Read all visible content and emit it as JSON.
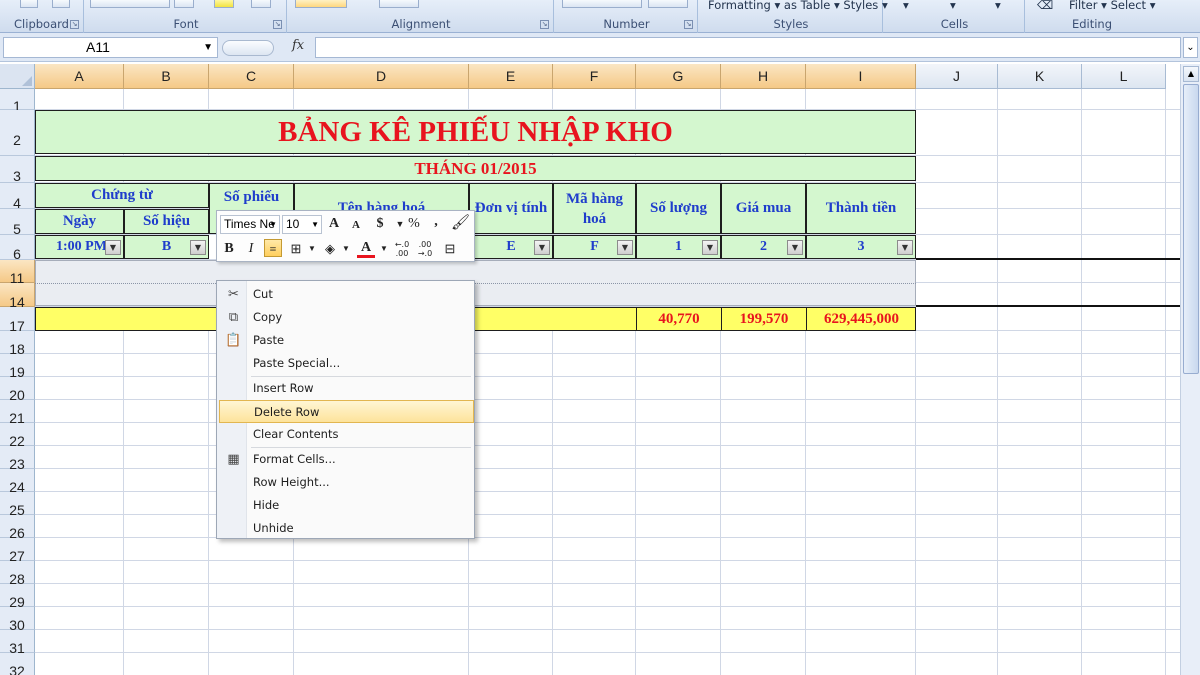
{
  "ribbon": {
    "groups": [
      {
        "label": "Clipboard"
      },
      {
        "label": "Font"
      },
      {
        "label": "Alignment"
      },
      {
        "label": "Number"
      },
      {
        "label": "Styles"
      },
      {
        "label": "Cells"
      },
      {
        "label": "Editing"
      }
    ],
    "styles_text": "Formatting ▾ as Table ▾ Styles ▾",
    "editing_text": "Filter ▾ Select ▾"
  },
  "formula_bar": {
    "name_box": "A11",
    "fx_label": "fx",
    "formula": ""
  },
  "columns": [
    "A",
    "B",
    "C",
    "D",
    "E",
    "F",
    "G",
    "H",
    "I",
    "J",
    "K",
    "L"
  ],
  "rows": [
    "1",
    "2",
    "3",
    "4",
    "5",
    "6",
    "11",
    "14",
    "17",
    "18",
    "19",
    "20",
    "21",
    "22",
    "23",
    "24",
    "25",
    "26",
    "27",
    "28",
    "29",
    "30",
    "31",
    "32"
  ],
  "sheet": {
    "title": "BẢNG KÊ PHIẾU NHẬP KHO",
    "subtitle": "THÁNG 01/2015",
    "h_chung_tu": "Chứng từ",
    "h_ngay": "Ngày",
    "h_so_hieu": "Số hiệu",
    "h_so_phieu": "Số phiếu",
    "h_ten_hang": "Tên hàng hoá",
    "h_don_vi": "Đơn vị tính",
    "h_ma_hang": "Mã hàng hoá",
    "h_so_luong": "Số lượng",
    "h_gia_mua": "Giá mua",
    "h_thanh_tien": "Thành tiền",
    "f_a": "1:00 PM",
    "f_b": "B",
    "f_e": "E",
    "f_f": "F",
    "f_g": "1",
    "f_h": "2",
    "f_i": "3",
    "total_g": "40,770",
    "total_h": "199,570",
    "total_i": "629,445,000"
  },
  "mini_toolbar": {
    "font_name": "Times Ne",
    "font_size": "10",
    "grow": "A",
    "shrink": "A",
    "currency": "$",
    "percent": "%",
    "comma": ",",
    "bold": "B",
    "italic": "I",
    "font_color": "A",
    "inc_dec": "←.0\n.00",
    "dec_dec": ".00\n→.0"
  },
  "context_menu": {
    "items": [
      {
        "label": "Cut"
      },
      {
        "label": "Copy"
      },
      {
        "label": "Paste"
      },
      {
        "label": "Paste Special..."
      },
      {
        "label": "Insert Row"
      },
      {
        "label": "Delete Row"
      },
      {
        "label": "Clear Contents"
      },
      {
        "label": "Format Cells..."
      },
      {
        "label": "Row Height..."
      },
      {
        "label": "Hide"
      },
      {
        "label": "Unhide"
      }
    ],
    "highlighted": "Delete Row"
  },
  "colors": {
    "header_green": "#d4f7cf",
    "total_yellow": "#ffff66",
    "title_red": "#e8141e",
    "header_blue": "#1f3dcc",
    "selected_header": "#f5c987"
  }
}
